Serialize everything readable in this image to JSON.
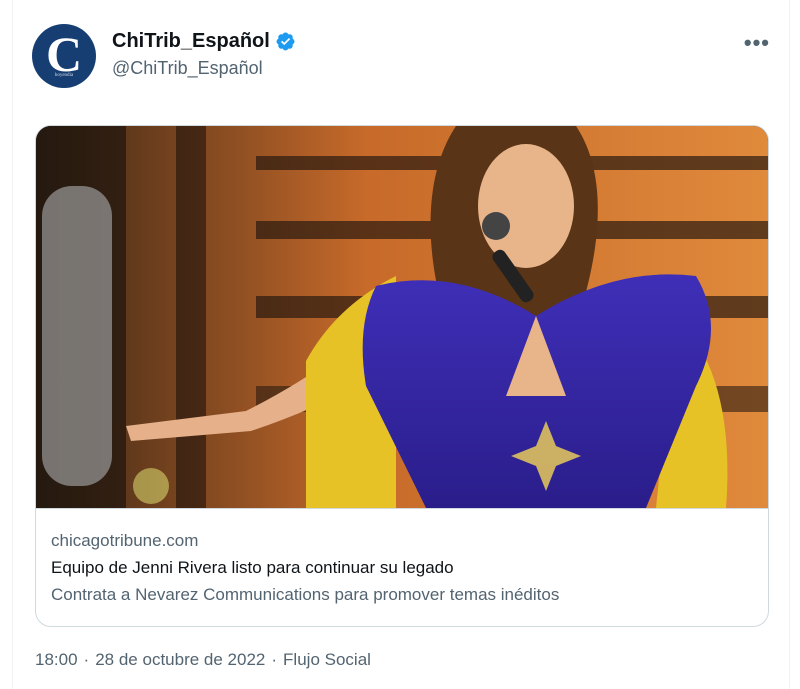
{
  "author": {
    "display_name": "ChiTrib_Español",
    "handle": "@ChiTrib_Español",
    "avatar_letter": "C",
    "avatar_subtext": "hoyendia",
    "verified": true
  },
  "more_label": "•••",
  "card": {
    "domain": "chicagotribune.com",
    "title": "Equipo de Jenni Rivera listo para continuar su legado",
    "description": "Contrata a Nevarez Communications para promover temas inéditos"
  },
  "meta": {
    "time": "18:00",
    "date": "28 de octubre de 2022",
    "source": "Flujo Social",
    "separator": "·"
  },
  "colors": {
    "brand_blue": "#1d9bf0",
    "secondary_text": "#536471",
    "border": "#cfd9de",
    "avatar_bg": "#173e72"
  }
}
